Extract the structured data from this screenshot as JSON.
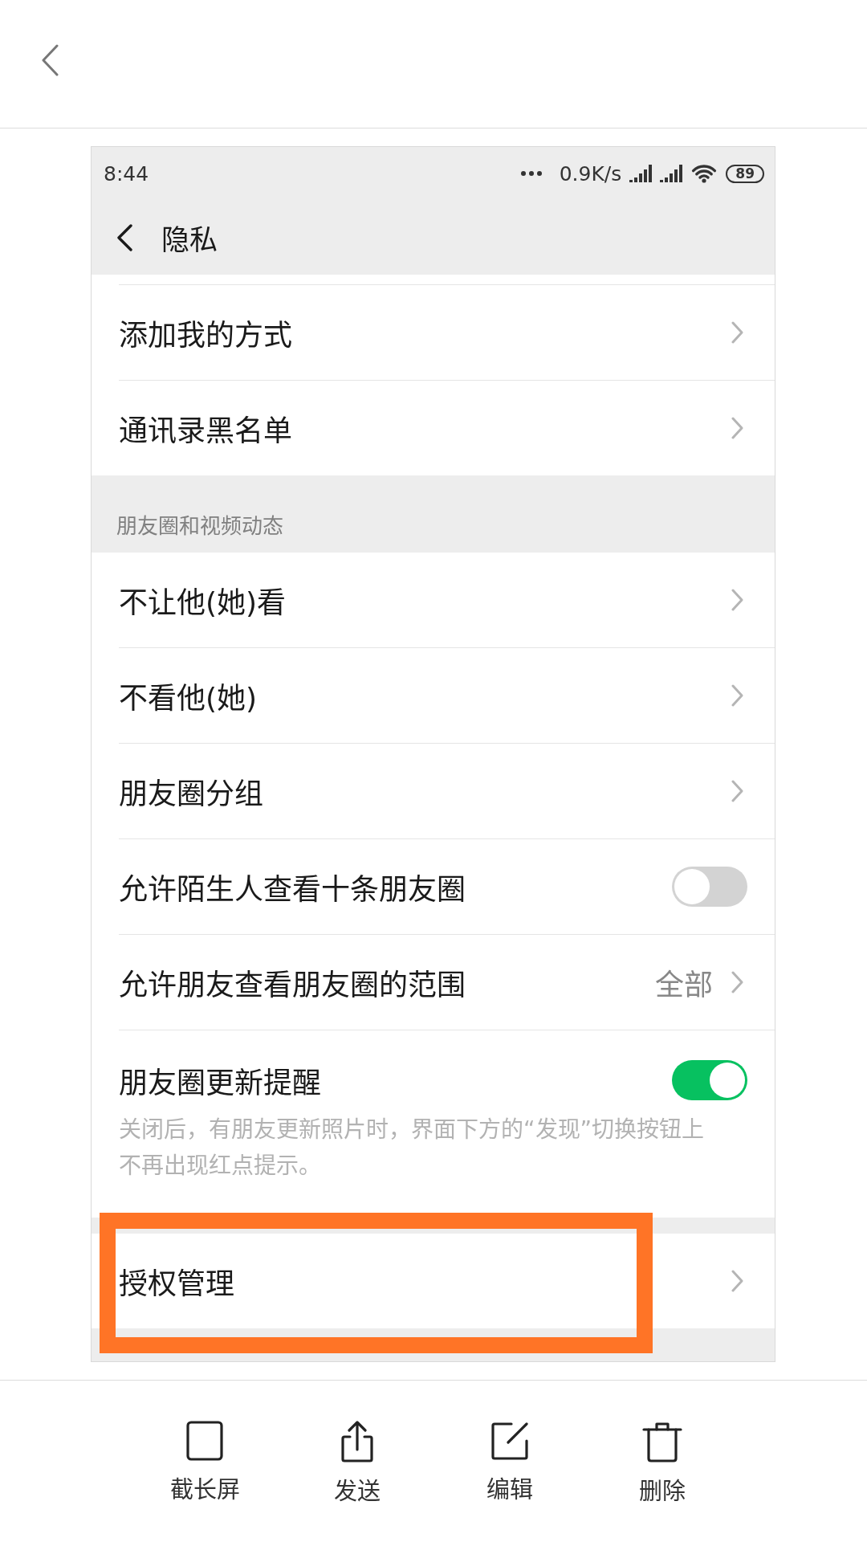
{
  "status_bar": {
    "time": "8:44",
    "network_speed": "0.9K/s",
    "battery": "89"
  },
  "title_bar": {
    "title": "隐私"
  },
  "groups": [
    {
      "rows": [
        {
          "kind": "link",
          "label": "添加我的方式",
          "highlighted": false
        },
        {
          "kind": "link",
          "label": "通讯录黑名单",
          "highlighted": false
        }
      ]
    },
    {
      "header": "朋友圈和视频动态",
      "rows": [
        {
          "kind": "link",
          "label": "不让他(她)看",
          "highlighted": false
        },
        {
          "kind": "link",
          "label": "不看他(她)",
          "highlighted": false
        },
        {
          "kind": "link",
          "label": "朋友圈分组",
          "highlighted": false
        },
        {
          "kind": "switch",
          "label": "允许陌生人查看十条朋友圈",
          "on": false,
          "highlighted": false
        },
        {
          "kind": "link",
          "label": "允许朋友查看朋友圈的范围",
          "value": "全部",
          "highlighted": false
        },
        {
          "kind": "switch",
          "label": "朋友圈更新提醒",
          "on": true,
          "description": "关闭后，有朋友更新照片时，界面下方的“发现”切换按钮上不再出现红点提示。",
          "highlighted": false
        }
      ]
    },
    {
      "rows": [
        {
          "kind": "link",
          "label": "授权管理",
          "highlighted": true
        }
      ]
    }
  ],
  "toolbar": [
    {
      "kind": "square",
      "label": "截长屏"
    },
    {
      "kind": "share",
      "label": "发送"
    },
    {
      "kind": "edit",
      "label": "编辑"
    },
    {
      "kind": "trash",
      "label": "删除"
    }
  ]
}
